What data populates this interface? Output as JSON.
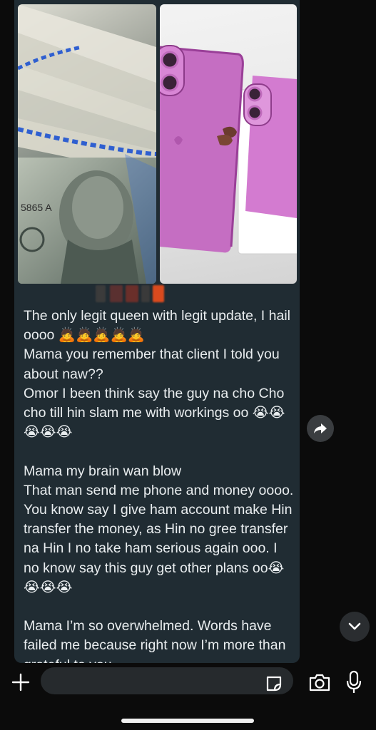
{
  "message": {
    "text": "The only legit queen with legit update, I hail oooo 🙇🙇🙇🙇🙇\nMama you remember that client I told you about naw??\nOmor I been think say the guy na cho Cho cho till hin slam me with workings oo 😭😭😭😭😭\n\nMama my brain wan blow\nThat man send me phone and money oooo. You know say I give ham account make Hin transfer the money, as Hin no gree transfer na Hin I no take ham serious again ooo. I no know say this guy get other plans oo😭😭😭😭\n\nMama I’m so overwhelmed. Words have failed me because right now I’m more than grateful to you"
  },
  "photos": [
    {
      "name": "money-photo",
      "banknote_text": "5865 A"
    },
    {
      "name": "pink-phones-photo"
    }
  ],
  "colors": {
    "bubble": "#202c33",
    "text": "#e9edef",
    "background": "#0b0b0b",
    "input": "#262a2d"
  },
  "icons": {
    "share": "share-arrow-icon",
    "scroll_down": "chevron-down-icon",
    "attach": "plus-icon",
    "sticker": "sticker-icon",
    "camera": "camera-icon",
    "mic": "microphone-icon"
  }
}
